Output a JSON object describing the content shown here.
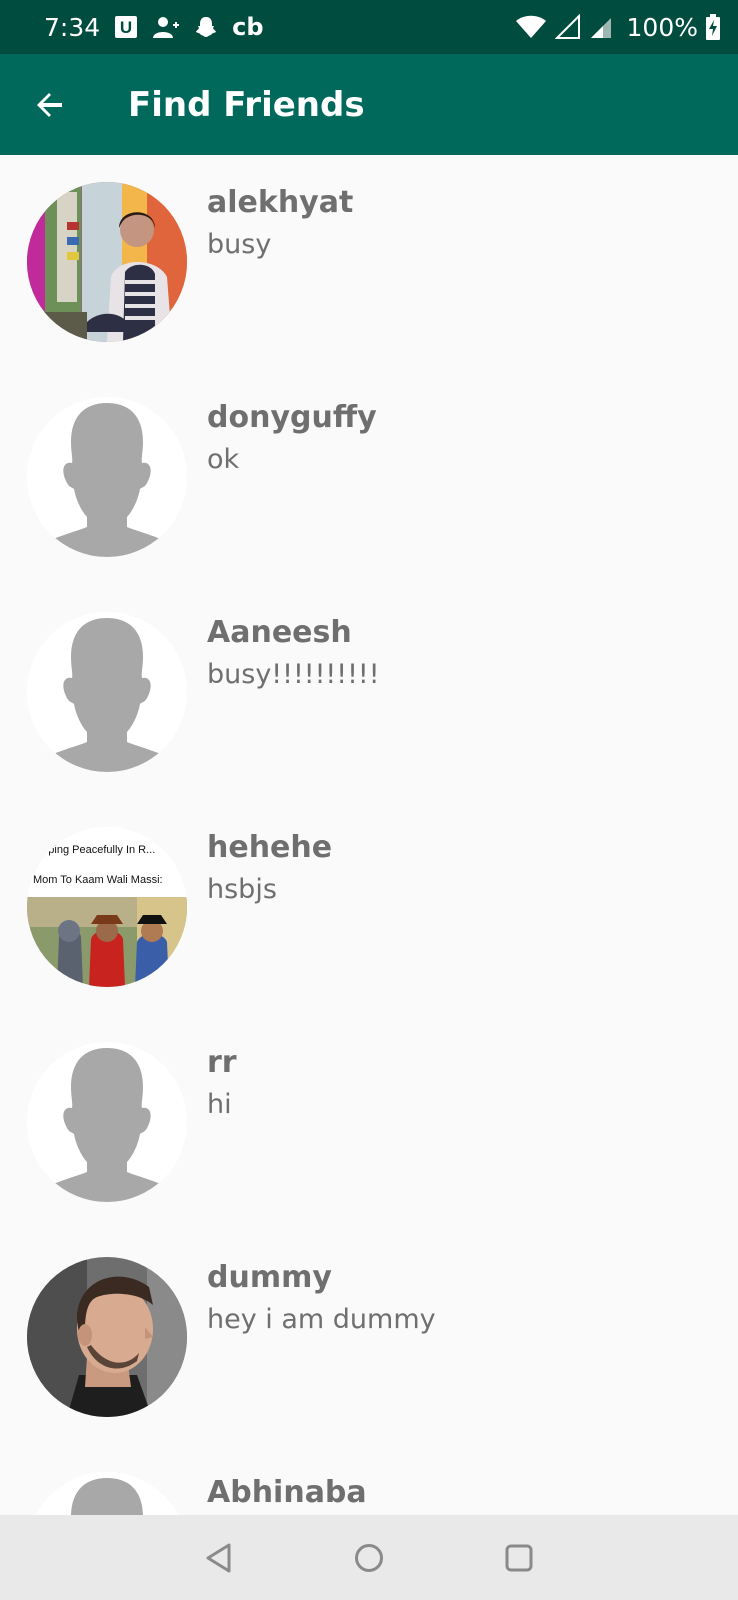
{
  "status_bar": {
    "time": "7:34",
    "notification_icons": [
      "u-app-icon",
      "person-add-icon",
      "snapchat-icon",
      "cb-icon"
    ],
    "cb_label": "cb",
    "u_label": "U",
    "battery": "100%"
  },
  "app_bar": {
    "title": "Find Friends"
  },
  "friends": [
    {
      "name": "alekhyat",
      "status": "busy",
      "avatar": "photo-woman"
    },
    {
      "name": "donyguffy",
      "status": "ok",
      "avatar": "default"
    },
    {
      "name": "Aaneesh",
      "status": "busy!!!!!!!!!!",
      "avatar": "default"
    },
    {
      "name": "hehehe",
      "status": "hsbjs",
      "avatar": "meme",
      "meme_text": [
        "...eping Peacefully In R...",
        "Mom To Kaam Wali Massi:"
      ]
    },
    {
      "name": "rr",
      "status": "hi",
      "avatar": "default"
    },
    {
      "name": "dummy",
      "status": "hey i am dummy",
      "avatar": "photo-man"
    },
    {
      "name": "Abhinaba",
      "status": "",
      "avatar": "default"
    }
  ],
  "colors": {
    "status_bar": "#004d40",
    "app_bar": "#00695c",
    "text": "#6f6f6f",
    "background": "#fafafa"
  }
}
